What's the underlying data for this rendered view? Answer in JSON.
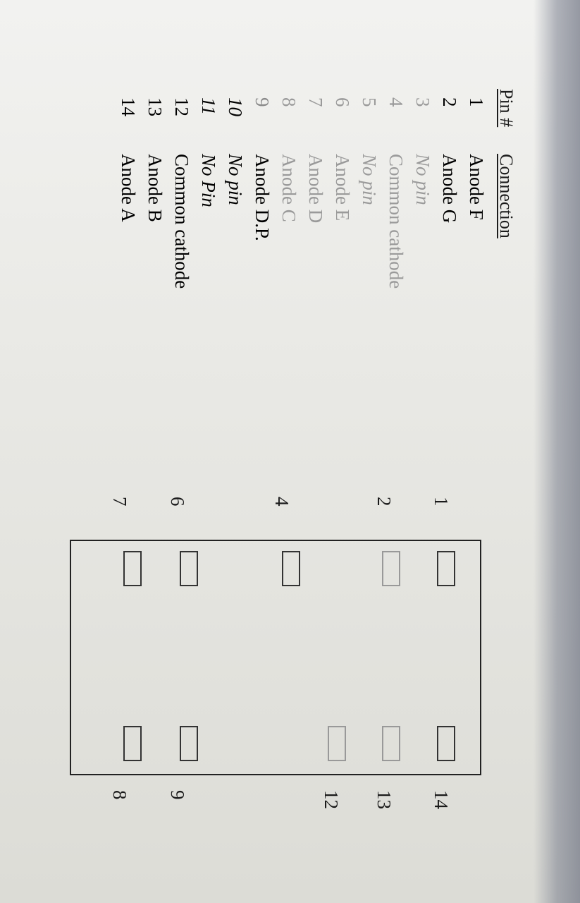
{
  "table": {
    "headers": {
      "pin": "Pin #",
      "connection": "Connection"
    },
    "rows": [
      {
        "pin": "1",
        "connection": "Anode F"
      },
      {
        "pin": "2",
        "connection": "Anode G"
      },
      {
        "pin": "3",
        "connection": "No pin"
      },
      {
        "pin": "4",
        "connection": "Common cathode"
      },
      {
        "pin": "5",
        "connection": "No pin"
      },
      {
        "pin": "6",
        "connection": "Anode E"
      },
      {
        "pin": "7",
        "connection": "Anode D"
      },
      {
        "pin": "8",
        "connection": "Anode C"
      },
      {
        "pin": "9",
        "connection": "Anode D.P."
      },
      {
        "pin": "10",
        "connection": "No pin"
      },
      {
        "pin": "11",
        "connection": "No Pin"
      },
      {
        "pin": "12",
        "connection": "Common cathode"
      },
      {
        "pin": "13",
        "connection": "Anode B"
      },
      {
        "pin": "14",
        "connection": "Anode A"
      }
    ]
  },
  "diagram": {
    "left_labels": [
      "1",
      "2",
      "4",
      "6",
      "7"
    ],
    "right_labels": [
      "14",
      "13",
      "12",
      "9",
      "8"
    ]
  }
}
